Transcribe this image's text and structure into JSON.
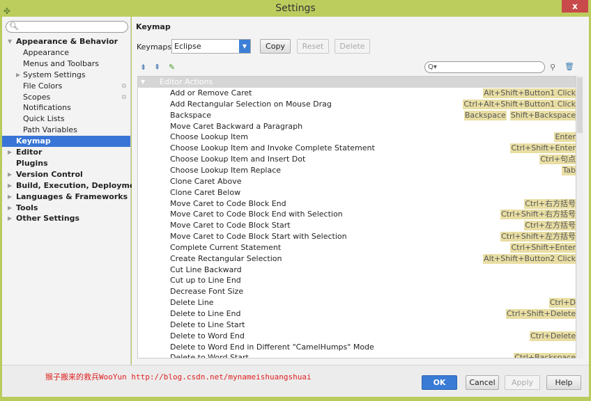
{
  "window": {
    "title": "Settings",
    "close": "x"
  },
  "sidebar": {
    "search_placeholder": "",
    "items": [
      {
        "label": "Appearance & Behavior",
        "level": 0,
        "bold": true,
        "expanded": true
      },
      {
        "label": "Appearance",
        "level": 1
      },
      {
        "label": "Menus and Toolbars",
        "level": 1
      },
      {
        "label": "System Settings",
        "level": 1,
        "collapsed": true
      },
      {
        "label": "File Colors",
        "level": 1,
        "copy": true
      },
      {
        "label": "Scopes",
        "level": 1,
        "copy": true
      },
      {
        "label": "Notifications",
        "level": 1
      },
      {
        "label": "Quick Lists",
        "level": 1
      },
      {
        "label": "Path Variables",
        "level": 1
      },
      {
        "label": "Keymap",
        "level": 0,
        "bold": true,
        "selected": true
      },
      {
        "label": "Editor",
        "level": 0,
        "bold": true,
        "collapsed": true
      },
      {
        "label": "Plugins",
        "level": 0,
        "bold": true
      },
      {
        "label": "Version Control",
        "level": 0,
        "bold": true,
        "collapsed": true
      },
      {
        "label": "Build, Execution, Deployment",
        "level": 0,
        "bold": true,
        "collapsed": true
      },
      {
        "label": "Languages & Frameworks",
        "level": 0,
        "bold": true,
        "collapsed": true
      },
      {
        "label": "Tools",
        "level": 0,
        "bold": true,
        "collapsed": true
      },
      {
        "label": "Other Settings",
        "level": 0,
        "bold": true,
        "collapsed": true
      }
    ]
  },
  "main": {
    "title": "Keymap",
    "keymaps_label": "Keymaps:",
    "keymap_value": "Eclipse",
    "copy": "Copy",
    "reset": "Reset",
    "delete": "Delete",
    "filter_placeholder": "Q▾",
    "group": "Editor Actions",
    "actions": [
      {
        "name": "Add or Remove Caret",
        "shortcuts": [
          "Alt+Shift+Button1 Click"
        ]
      },
      {
        "name": "Add Rectangular Selection on Mouse Drag",
        "shortcuts": [
          "Ctrl+Alt+Shift+Button1 Click"
        ]
      },
      {
        "name": "Backspace",
        "shortcuts": [
          "Backspace",
          "Shift+Backspace"
        ]
      },
      {
        "name": "Move Caret Backward a Paragraph",
        "shortcuts": []
      },
      {
        "name": "Choose Lookup Item",
        "shortcuts": [
          "Enter"
        ]
      },
      {
        "name": "Choose Lookup Item and Invoke Complete Statement",
        "shortcuts": [
          "Ctrl+Shift+Enter"
        ]
      },
      {
        "name": "Choose Lookup Item and Insert Dot",
        "shortcuts": [
          "Ctrl+句点"
        ]
      },
      {
        "name": "Choose Lookup Item Replace",
        "shortcuts": [
          "Tab"
        ]
      },
      {
        "name": "Clone Caret Above",
        "shortcuts": []
      },
      {
        "name": "Clone Caret Below",
        "shortcuts": []
      },
      {
        "name": "Move Caret to Code Block End",
        "shortcuts": [
          "Ctrl+右方括号"
        ]
      },
      {
        "name": "Move Caret to Code Block End with Selection",
        "shortcuts": [
          "Ctrl+Shift+右方括号"
        ]
      },
      {
        "name": "Move Caret to Code Block Start",
        "shortcuts": [
          "Ctrl+左方括号"
        ]
      },
      {
        "name": "Move Caret to Code Block Start with Selection",
        "shortcuts": [
          "Ctrl+Shift+左方括号"
        ]
      },
      {
        "name": "Complete Current Statement",
        "shortcuts": [
          "Ctrl+Shift+Enter"
        ]
      },
      {
        "name": "Create Rectangular Selection",
        "shortcuts": [
          "Alt+Shift+Button2 Click"
        ]
      },
      {
        "name": "Cut Line Backward",
        "shortcuts": []
      },
      {
        "name": "Cut up to Line End",
        "shortcuts": []
      },
      {
        "name": "Decrease Font Size",
        "shortcuts": []
      },
      {
        "name": "Delete Line",
        "shortcuts": [
          "Ctrl+D"
        ]
      },
      {
        "name": "Delete to Line End",
        "shortcuts": [
          "Ctrl+Shift+Delete"
        ]
      },
      {
        "name": "Delete to Line Start",
        "shortcuts": []
      },
      {
        "name": "Delete to Word End",
        "shortcuts": [
          "Ctrl+Delete"
        ]
      },
      {
        "name": "Delete to Word End in Different \"CamelHumps\" Mode",
        "shortcuts": []
      },
      {
        "name": "Delete to Word Start",
        "shortcuts": [
          "Ctrl+Backspace"
        ]
      }
    ]
  },
  "footer": {
    "watermark": "猴子搬来的救兵WooYun http://blog.csdn.net/mynameishuangshuai",
    "ok": "OK",
    "cancel": "Cancel",
    "apply": "Apply",
    "help": "Help"
  },
  "colors": {
    "titlebar": "#bccd5e",
    "selection": "#3875d7",
    "shortcut_bg": "#e9dea3",
    "close": "#c94a4a"
  }
}
